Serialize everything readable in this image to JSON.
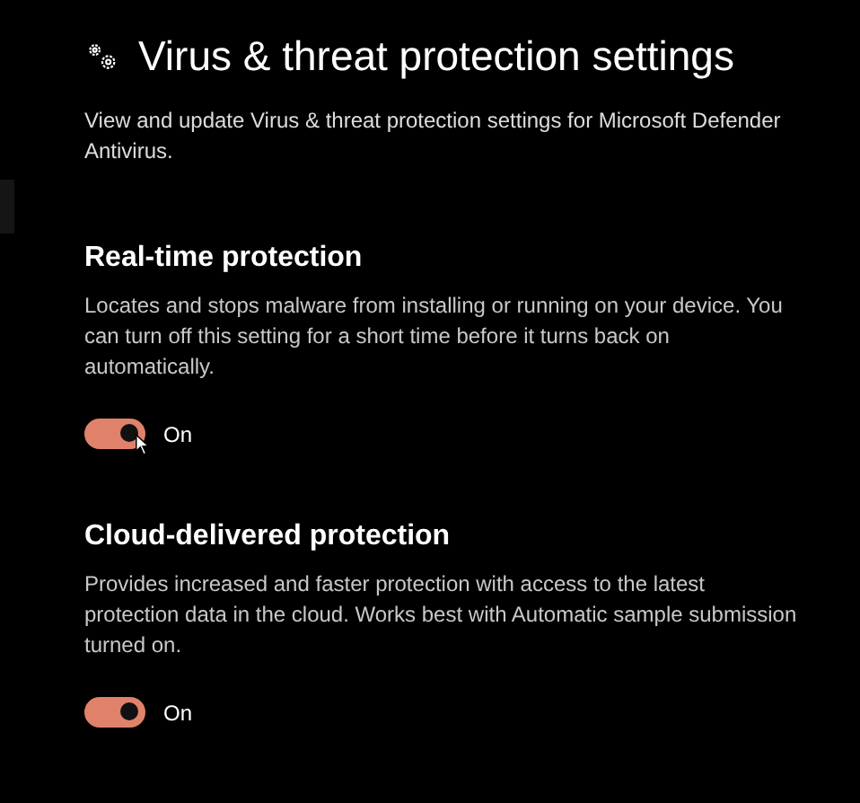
{
  "page": {
    "title": "Virus & threat protection settings",
    "description": "View and update Virus & threat protection settings for Microsoft Defender Antivirus."
  },
  "sections": [
    {
      "heading": "Real-time protection",
      "description": "Locates and stops malware from installing or running on your device. You can turn off this setting for a short time before it turns back on automatically.",
      "toggle": {
        "on": true,
        "label": "On"
      }
    },
    {
      "heading": "Cloud-delivered protection",
      "description": "Provides increased and faster protection with access to the latest protection data in the cloud. Works best with Automatic sample submission turned on.",
      "toggle": {
        "on": true,
        "label": "On"
      }
    }
  ]
}
